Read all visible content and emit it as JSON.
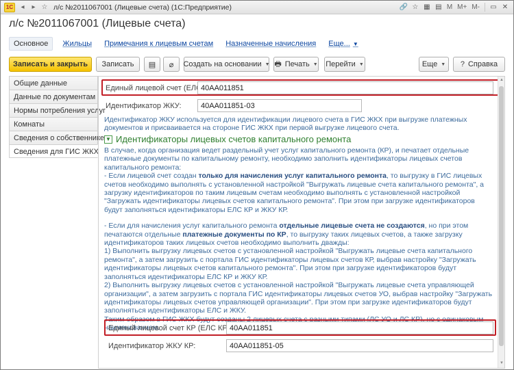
{
  "window": {
    "title": "л/с №2011067001 (Лицевые счета)  (1С:Предприятие)",
    "logo_text": "1С",
    "tb_right_labels": [
      "M",
      "M+",
      "M-"
    ]
  },
  "page": {
    "title": "л/с №2011067001 (Лицевые счета)"
  },
  "tabs": [
    {
      "label": "Основное",
      "active": true
    },
    {
      "label": "Жильцы"
    },
    {
      "label": "Примечания к лицевым счетам"
    },
    {
      "label": "Назначенные начисления"
    },
    {
      "label": "Еще..."
    }
  ],
  "toolbar": {
    "save_close": "Записать и закрыть",
    "save": "Записать",
    "create_based": "Создать на основании",
    "print": "Печать",
    "goto": "Перейти",
    "more": "Еще",
    "help": "Справка"
  },
  "leftnav": [
    {
      "label": "Общие данные"
    },
    {
      "label": "Данные по документам"
    },
    {
      "label": "Нормы потребления услуг"
    },
    {
      "label": "Комнаты"
    },
    {
      "label": "Сведения о собственнике"
    },
    {
      "label": "Сведения для ГИС ЖКХ",
      "active": true
    }
  ],
  "fields": {
    "els_label": "Единый лицевой счет (ЕЛС):",
    "els_value": "40АА011851",
    "zhku_label": "Идентификатор ЖКУ:",
    "zhku_value": "40АА011851-03",
    "els_kr_label": "Единый лицевой счет КР (ЕЛС КР) :",
    "els_kr_value": "40АА011851",
    "zhku_kr_label": "Идентификатор ЖКУ КР:",
    "zhku_kr_value": "40АА011851-05"
  },
  "info1": "Идентификатор ЖКУ используется для идентификации лицевого счета в ГИС ЖКХ при выгрузке платежных документов и присваивается на стороне ГИС ЖКХ при первой выгрузке лицевого счета.",
  "section": {
    "title": "Идентификаторы лицевых счетов капитального ремонта"
  },
  "info2": {
    "p1": "В случае, когда организация ведет раздельный учет услуг капитального ремонта (КР), и печатает отдельные платежные документы по капитальному ремонту, необходимо заполнить идентификаторы лицевых счетов капитального ремонта:",
    "p2a": "- Если лицевой счет создан ",
    "p2b": "только для начисления услуг капитального ремонта",
    "p2c": ", то выгрузку в ГИС лицевых счетов необходимо выполнять с установленной настройкой \"Выгружать лицевые счета капитального ремонта\", а загрузку идентификаторов по таким лицевым счетам необходимо выполнять с установленной настройкой \"Загружать идентификаторы лицевых счетов капитального ремонта\". При этом при загрузке идентификаторов будут заполняться идентификаторы ЕЛС КР и ЖКУ КР.",
    "p3a": "- Если для начисления услуг капитального ремонта ",
    "p3b": "отдельные лицевые счета не создаются",
    "p3c": ", но при этом печатаются отдельные ",
    "p3d": "платежные документы по КР",
    "p3e": ", то выгрузку таких лицевых счетов, а также загрузку идентификаторов таких лицевых счетов необходимо выполнить дважды:",
    "p4": "1) Выполнить выгрузку лицевых счетов с установленной настройкой \"Выгружать лицевые счета капитального ремонта\", а затем загрузить с портала ГИС идентификаторы лицевых счетов КР, выбрав настройку \"Загружать идентификаторы лицевых счетов капитального ремонта\". При этом при загрузке идентификаторов будут заполняться идентификаторы ЕЛС КР и ЖКУ КР.",
    "p5": "2) Выполнить выгрузку лицевых счетов с установленной настройкой \"Выгружать лицевые счета управляющей организации\", а затем загрузить с портала ГИС идентификаторы лицевых счетов УО, выбрав настройку \"Загружать идентификаторы лицевых счетов управляющей организации\". При этом при загрузке идентификаторов будут заполняться идентификаторы ЕЛС и ЖКУ.",
    "p6": "Таким образом в ГИС ЖКХ будут созданы 2 лицевых счета с разными типами (ЛС УО и ЛС КР), но с одинаковым наименованием."
  },
  "colors": {
    "highlight": "#c11d25",
    "primary": "#f5c200",
    "info_text": "#3d6b9c",
    "section_green": "#2f7f2f",
    "link": "#0d47a1"
  }
}
